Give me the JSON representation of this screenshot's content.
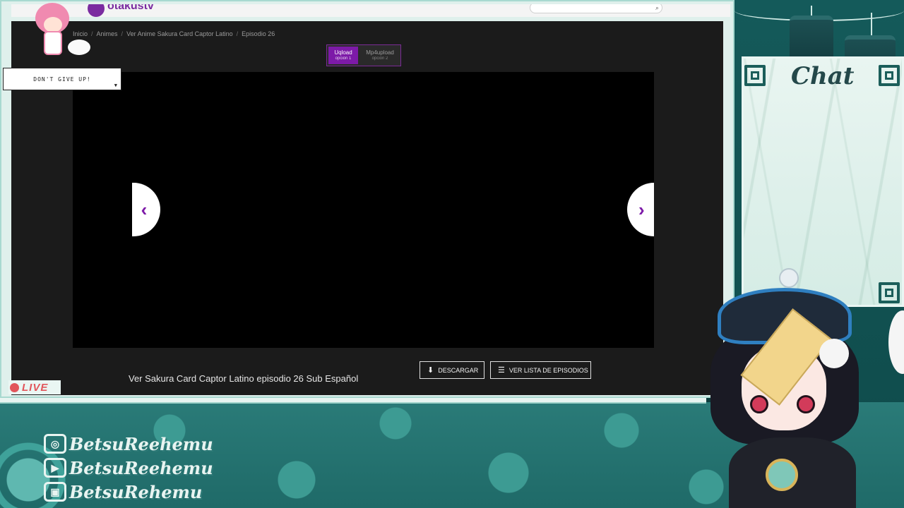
{
  "browser": {
    "logo": "otakustv",
    "breadcrumb": [
      "Inicio",
      "Animes",
      "Ver Anime Sakura Card Captor Latino",
      "Episodio 26"
    ],
    "servers": [
      {
        "name": "Uqload",
        "sub": "opción 1",
        "active": true
      },
      {
        "name": "Mp4upload",
        "sub": "opción 2",
        "active": false
      }
    ],
    "episode_title": "Ver Sakura Card Captor Latino episodio 26 Sub Español",
    "download_label": "DESCARGAR",
    "episode_list_label": "VER LISTA DE EPISODIOS",
    "accent_color": "#7d1aa8"
  },
  "overlay": {
    "motivation": "DON'T GIVE UP!",
    "live_label": "LIVE",
    "chat_title": "Chat",
    "socials": [
      {
        "icon": "instagram-icon",
        "handle": "BetsuReehemu"
      },
      {
        "icon": "youtube-icon",
        "handle": "BetsuReehemu"
      },
      {
        "icon": "twitch-icon",
        "handle": "BetsuRehemu"
      }
    ]
  },
  "icons": {
    "prev": "‹",
    "next": "›",
    "download": "⬇",
    "list": "☰",
    "search": "⌕",
    "instagram": "◎",
    "youtube": "▶",
    "twitch": "▣"
  }
}
